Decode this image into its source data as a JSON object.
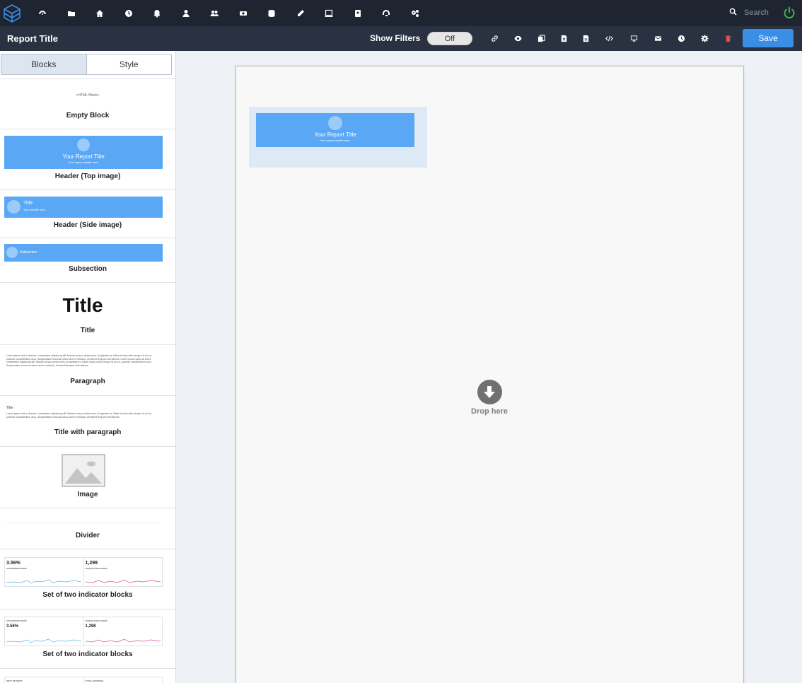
{
  "nav": {
    "icons": [
      "dashboard-icon",
      "folder-icon",
      "home-icon",
      "clock-icon",
      "bell-icon",
      "user-icon",
      "users-icon",
      "group-icon",
      "database-icon",
      "pencil-icon",
      "laptop-icon",
      "contacts-icon",
      "support-icon",
      "cogs-icon"
    ],
    "search_placeholder": "Search"
  },
  "toolbar": {
    "title": "Report Title",
    "show_filters": "Show Filters",
    "filter_state": "Off",
    "save_label": "Save"
  },
  "sidebar": {
    "tabs": [
      "Blocks",
      "Style"
    ],
    "blocks": {
      "empty": {
        "preview": "<HTML Block>",
        "label": "Empty Block"
      },
      "header_top": {
        "title": "Your Report Title",
        "subtitle": "Your report subtitle here.",
        "label": "Header (Top image)"
      },
      "header_side": {
        "title": "Title",
        "subtitle": "Your subtitle here.",
        "label": "Header (Side image)"
      },
      "subsection": {
        "title": "Subsection",
        "label": "Subsection"
      },
      "title": {
        "preview": "Title",
        "label": "Title"
      },
      "paragraph": {
        "text": "Lorem ipsum dolor sit amet, consectetur adipiscing elit. Mauris cursus varius enim, id egestas ex. Etiam luctus nulla, tempor id mi eu, pulvinar condimentum arcu. Suspendisse rhoncus netus sed ex vehicula, hendrerit tempus velit ultrices. Lorem ipsum dolor sit amet, consectetur adipiscing elit. Mauris cursus varius enim, id egestas ex. Etiam luctus nulla, tempor id mi eu, pulvinar condimentum arcu. Suspendisse rhoncus netus sed ex vehicula, hendrerit tempus velit ultrices.",
        "label": "Paragraph"
      },
      "title_paragraph": {
        "title": "Title",
        "text": "Lorem ipsum dolor sit amet, consectetur adipiscing elit. Mauris cursus varius enim, id egestas ex. Etiam luctus nulla, tempor id mi eu, pulvinar condimentum arcu. Suspendisse rhoncus netus sed ex vehicula, hendrerit tempus velit ultrices.",
        "label": "Title with paragraph"
      },
      "image": {
        "label": "Image"
      },
      "divider": {
        "label": "Divider"
      },
      "indicators1": {
        "v1": "3.56%",
        "l1": "CONVERSION RATE",
        "v2": "1,298",
        "l2": "UNIQUE PURCHASES",
        "label": "Set of two indicator blocks"
      },
      "indicators2": {
        "l1": "CONVERSION RATE",
        "v1": "3.56%",
        "l2": "UNIQUE PURCHASES",
        "v2": "1,298",
        "label": "Set of two indicator blocks"
      },
      "partial": {
        "l1": "NEXT PAYMENT",
        "l2": "TOTAL EARNINGS"
      }
    }
  },
  "canvas": {
    "placed_title": "Your Report Title",
    "placed_subtitle": "Your report subtitle here.",
    "drop_label": "Drop here"
  },
  "colors": {
    "accent": "#3a8ee6",
    "header_blue": "#5aa7f6",
    "nav_bg": "#1e2430",
    "toolbar_bg": "#2a3140",
    "power": "#3bb54a",
    "trash": "#d9534f"
  }
}
